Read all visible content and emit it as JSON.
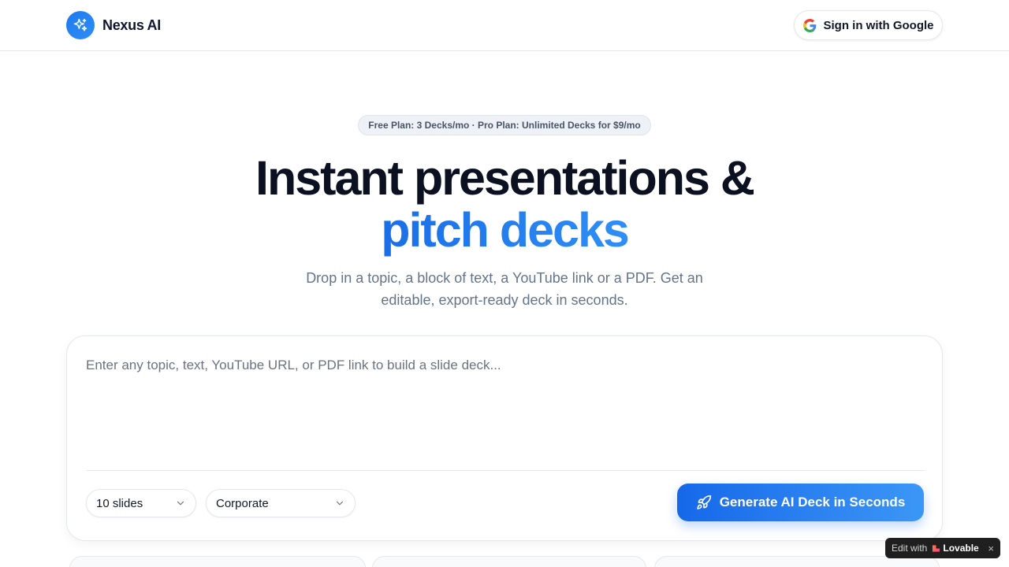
{
  "header": {
    "brand_name": "Nexus AI",
    "signin_label": "Sign in with Google"
  },
  "hero": {
    "badge": "Free Plan: 3 Decks/mo · Pro Plan: Unlimited Decks for $9/mo",
    "title_line1": "Instant presentations &",
    "title_line2": "pitch decks",
    "subtitle": "Drop in a topic, a block of text, a YouTube link or a PDF. Get an editable, export-ready deck in seconds."
  },
  "composer": {
    "placeholder": "Enter any topic, text, YouTube URL, or PDF link to build a slide deck...",
    "slides_select": "10 slides",
    "style_select": "Corporate",
    "generate_label": "Generate AI Deck in Seconds"
  },
  "lovable_badge": {
    "edit_text": "Edit with",
    "brand": "Lovable",
    "close": "×"
  },
  "colors": {
    "accent": "#1d7af0",
    "accent_light": "#3b97f6",
    "text_dark": "#0b1120",
    "muted": "#64748b"
  },
  "icons": {
    "brand": "sparkles-icon",
    "google": "google-g-icon",
    "chevron": "chevron-down-icon",
    "rocket": "rocket-icon",
    "lovable": "heart-icon",
    "close": "close-icon"
  }
}
